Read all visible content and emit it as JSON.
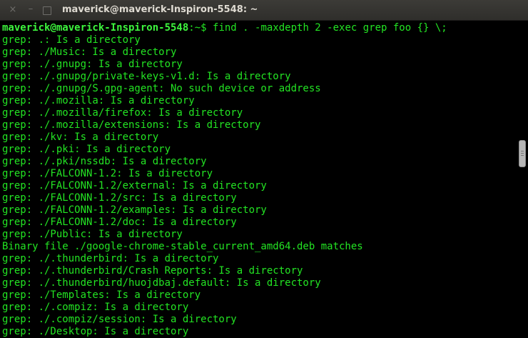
{
  "window": {
    "title": "maverick@maverick-Inspiron-5548: ~",
    "buttons": {
      "close": "×",
      "minimize": "–",
      "maximize": ""
    }
  },
  "terminal": {
    "prompt": "maverick@maverick-Inspiron-5548",
    "prompt_suffix": ":~$ ",
    "command": "find . -maxdepth 2 -exec grep foo {} \\;",
    "output": [
      "grep: .: Is a directory",
      "grep: ./Music: Is a directory",
      "grep: ./.gnupg: Is a directory",
      "grep: ./.gnupg/private-keys-v1.d: Is a directory",
      "grep: ./.gnupg/S.gpg-agent: No such device or address",
      "grep: ./.mozilla: Is a directory",
      "grep: ./.mozilla/firefox: Is a directory",
      "grep: ./.mozilla/extensions: Is a directory",
      "grep: ./kv: Is a directory",
      "grep: ./.pki: Is a directory",
      "grep: ./.pki/nssdb: Is a directory",
      "grep: ./FALCONN-1.2: Is a directory",
      "grep: ./FALCONN-1.2/external: Is a directory",
      "grep: ./FALCONN-1.2/src: Is a directory",
      "grep: ./FALCONN-1.2/examples: Is a directory",
      "grep: ./FALCONN-1.2/doc: Is a directory",
      "grep: ./Public: Is a directory",
      "Binary file ./google-chrome-stable_current_amd64.deb matches",
      "grep: ./.thunderbird: Is a directory",
      "grep: ./.thunderbird/Crash Reports: Is a directory",
      "grep: ./.thunderbird/huojdbaj.default: Is a directory",
      "grep: ./Templates: Is a directory",
      "grep: ./.compiz: Is a directory",
      "grep: ./.compiz/session: Is a directory",
      "grep: ./Desktop: Is a directory"
    ]
  },
  "colors": {
    "background": "#000000",
    "text": "#23e423",
    "prompt": "#3df33d",
    "titlebar": "#3c3b37",
    "title_text": "#dfdbd2"
  },
  "icons": {
    "close": "close-icon",
    "minimize": "minimize-icon",
    "maximize": "maximize-icon"
  }
}
